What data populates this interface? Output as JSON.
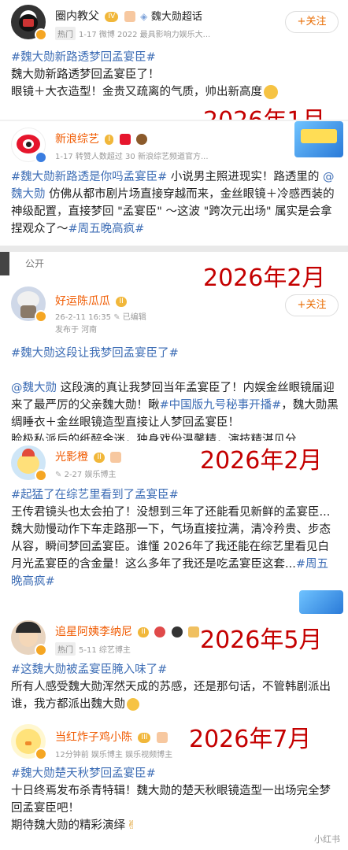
{
  "post1": {
    "name": "圈内教父",
    "level": "IV",
    "super_topic": "魏大勋超话",
    "hot_tag": "热门",
    "meta": "1-17  微博 2022 最具影响力娱乐大...",
    "follow": "+关注",
    "topic": "#魏大勋新路透梦回孟宴臣#",
    "line1": "魏大勋新路透梦回孟宴臣了！",
    "line2": "眼镜＋大衣造型！金贵又疏离的气质，帅出新高度",
    "date": "2026年1月"
  },
  "post2": {
    "name": "新浪综艺",
    "level": "I",
    "meta": "1-17  转赞人数超过 30    新浪综艺频道官方...",
    "topic1": "#魏大勋新路透是你吗孟宴臣#",
    "text1": " 小说男主照进现实！路透里的 ",
    "mention": "@魏大勋",
    "text2": " 仿佛从都市剧片场直接穿越而来，金丝眼镜＋冷感西装的神级配置，直接梦回 \"孟宴臣\" ～这波 \"跨次元出场\" 属实是会拿捏观众了～",
    "topic2": "#周五晚高疯#"
  },
  "post3": {
    "public_label": "公开",
    "name": "好运陈瓜瓜",
    "level": "II",
    "meta1": "26-2-11 16:35",
    "edited": "已编辑",
    "meta2": "发布于 河南",
    "follow": "+关注",
    "topic": "#魏大勋这段让我梦回孟宴臣了#",
    "mention": "@魏大勋",
    "text1": " 这段演的真让我梦回当年孟宴臣了！内娱金丝眼镜届迎来了最严厉的父亲魏大勋！瞅",
    "topic2": "#中国版九号秘事开播#",
    "text2": "，魏大勋黑绸睡衣＋金丝眼镜造型直接让人梦回孟宴臣！",
    "text3": "脸极私派后的纸醉金迷，独身戏份温馨精，演技精湛见分",
    "date": "2026年2月"
  },
  "post4": {
    "name": "光影橙",
    "level": "II",
    "meta": "2-27  娱乐博主",
    "topic": "#起猛了在综艺里看到了孟宴臣#",
    "p1": "王传君镜头也太会拍了！没想到三年了还能看见新鲜的孟宴臣...",
    "p2a": "魏大勋慢动作下车走路那一下，气场直接拉满，清冷矜贵、步态从容，瞬间梦回孟宴臣。谁懂 2026年了我还能在综艺里看见白月光孟宴臣的含金量！这么多年了我还是吃孟宴臣这套...",
    "topic2": "#周五晚高疯#",
    "date": "2026年2月"
  },
  "post5": {
    "name": "追星阿姨李纳尼",
    "level": "II",
    "hot_tag": "热门",
    "meta": "5-11  综艺博主",
    "topic": "#这魏大勋被孟宴臣腌入味了#",
    "text": "所有人感受魏大勋浑然天成的苏感，还是那句话，不管韩剧派出谁，我方都派出魏大勋",
    "date": "2026年5月"
  },
  "post6": {
    "name": "当红炸子鸡小陈",
    "level": "III",
    "meta": "12分钟前  娱乐博主  娱乐视频博主",
    "topic": "#魏大勋楚天秋梦回孟宴臣#",
    "text1": "十日终焉发布杀青特辑！魏大勋的楚天秋眼镜造型一出场完全梦回孟宴臣吧！",
    "text2": "期待魏大勋的精彩演绎",
    "date": "2026年7月",
    "watermark": "小红书"
  },
  "colors": {
    "accent": "#f05a00",
    "topic": "#3d6db5",
    "date": "#c40000"
  }
}
